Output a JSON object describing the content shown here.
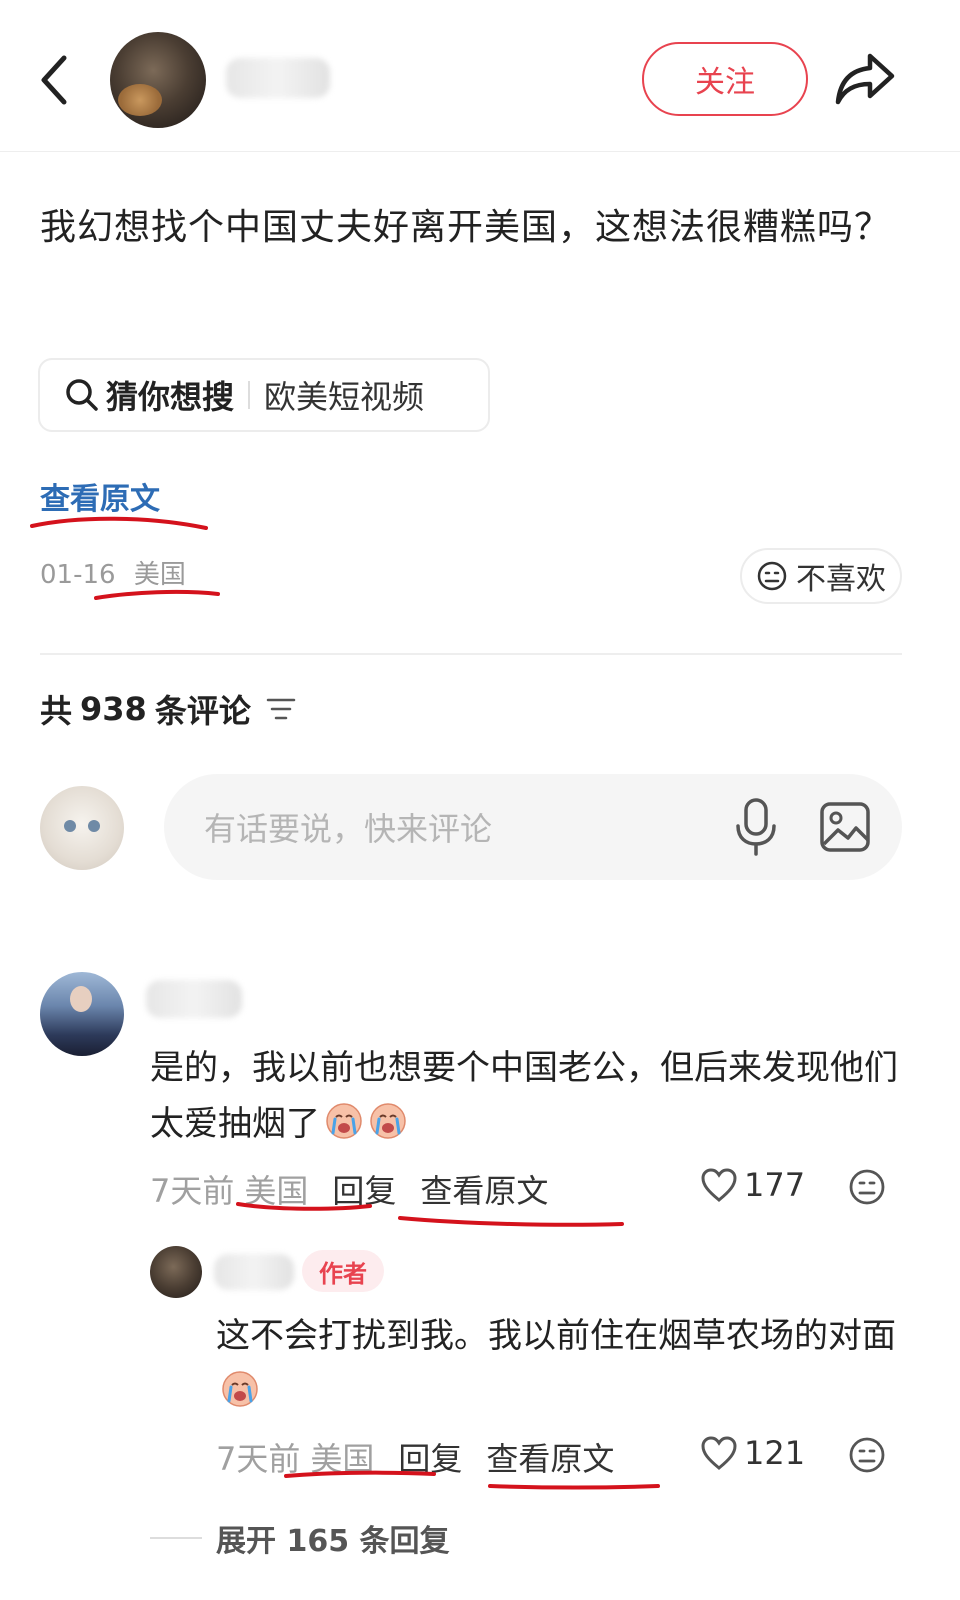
{
  "header": {
    "follow_label": "关注"
  },
  "post": {
    "title": "我幻想找个中国丈夫好离开美国，这想法很糟糕吗？",
    "search_chip": {
      "label": "猜你想搜",
      "query": "欧美短视频"
    },
    "view_original": "查看原文",
    "date": "01-16",
    "region": "美国",
    "dislike_label": "不喜欢"
  },
  "comments": {
    "count_prefix": "共",
    "count": "938",
    "count_suffix": "条评论",
    "input_placeholder": "有话要说，快来评论",
    "items": [
      {
        "text": "是的，我以前也想要个中国老公，但后来发现他们太爱抽烟了",
        "time": "7天前",
        "region": "美国",
        "reply_label": "回复",
        "view_original": "查看原文",
        "likes": "177",
        "replies": [
          {
            "badge": "作者",
            "text": "这不会打扰到我。我以前住在烟草农场的对面",
            "time": "7天前",
            "region": "美国",
            "reply_label": "回复",
            "view_original": "查看原文",
            "likes": "121"
          }
        ],
        "expand_label": "展开 165 条回复"
      }
    ]
  },
  "colors": {
    "accent_red": "#e8434f",
    "link_blue": "#2d6cb5",
    "annotation_red": "#d4121c"
  },
  "icons": [
    "back-icon",
    "share-icon",
    "search-icon",
    "dislike-face-icon",
    "sort-icon",
    "mic-icon",
    "image-icon",
    "heart-icon",
    "emoji-reaction-icon",
    "crying-emoji-icon"
  ]
}
